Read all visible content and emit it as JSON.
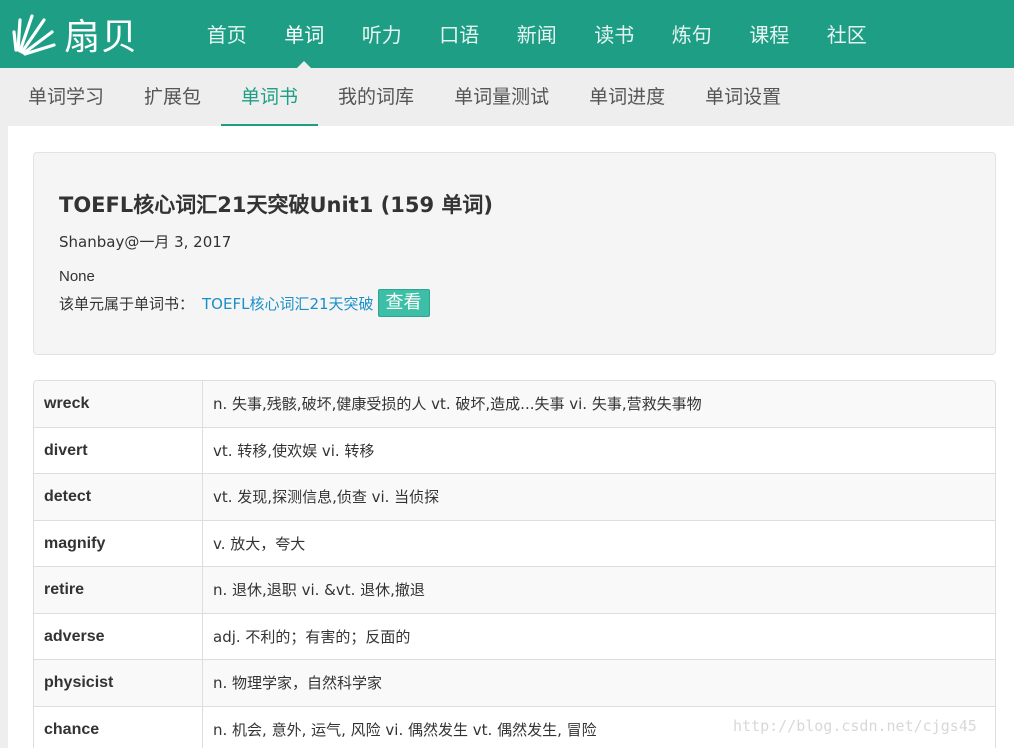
{
  "brand": {
    "name": "扇贝",
    "logo_icon": "shell-fan-icon"
  },
  "main_nav": [
    {
      "label": "首页",
      "active": false
    },
    {
      "label": "单词",
      "active": true
    },
    {
      "label": "听力",
      "active": false
    },
    {
      "label": "口语",
      "active": false
    },
    {
      "label": "新闻",
      "active": false
    },
    {
      "label": "读书",
      "active": false
    },
    {
      "label": "炼句",
      "active": false
    },
    {
      "label": "课程",
      "active": false
    },
    {
      "label": "社区",
      "active": false
    }
  ],
  "sub_nav": [
    {
      "label": "单词学习",
      "active": false
    },
    {
      "label": "扩展包",
      "active": false
    },
    {
      "label": "单词书",
      "active": true
    },
    {
      "label": "我的词库",
      "active": false
    },
    {
      "label": "单词量测试",
      "active": false
    },
    {
      "label": "单词进度",
      "active": false
    },
    {
      "label": "单词设置",
      "active": false
    }
  ],
  "unit": {
    "title": "TOEFL核心词汇21天突破Unit1 (159 单词)",
    "meta": "Shanbay@一月 3, 2017",
    "description": "None",
    "belongs_label": "该单元属于单词书：",
    "book_link": "TOEFL核心词汇21天突破",
    "view_button": "查看"
  },
  "words": [
    {
      "word": "wreck",
      "definition": "n. 失事,残骸,破坏,健康受损的人 vt. 破坏,造成...失事 vi. 失事,营救失事物"
    },
    {
      "word": "divert",
      "definition": "vt. 转移,使欢娱 vi. 转移"
    },
    {
      "word": "detect",
      "definition": "vt. 发现,探测信息,侦查 vi. 当侦探"
    },
    {
      "word": "magnify",
      "definition": "v. 放大，夸大"
    },
    {
      "word": "retire",
      "definition": "n. 退休,退职 vi. &vt. 退休,撤退"
    },
    {
      "word": "adverse",
      "definition": "adj. 不利的；有害的；反面的"
    },
    {
      "word": "physicist",
      "definition": "n. 物理学家，自然科学家"
    },
    {
      "word": "chance",
      "definition": "n. 机会, 意外, 运气, 风险 vi. 偶然发生 vt. 偶然发生, 冒险"
    }
  ],
  "watermark": "http://blog.csdn.net/cjgs45",
  "colors": {
    "brand_green": "#1f9e86",
    "link_blue": "#1a8fc7",
    "button_green": "#3cbfa6"
  }
}
